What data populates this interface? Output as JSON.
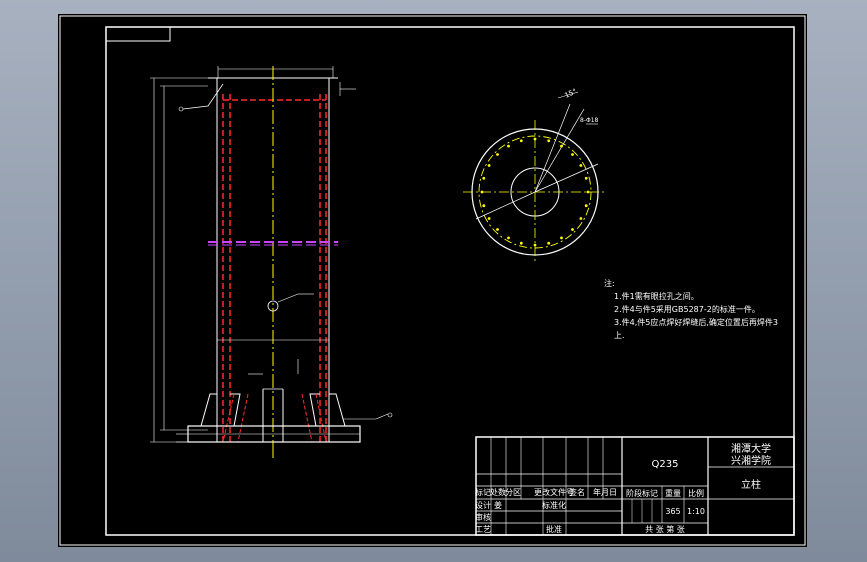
{
  "title_block": {
    "material": "Q235",
    "school_line1": "湘潭大学",
    "school_line2": "兴湘学院",
    "part_name": "立柱",
    "headers_left": [
      "标记",
      "处数",
      "分区",
      "更改文件号",
      "签名",
      "年月日"
    ],
    "row_design": [
      "设计",
      "姜",
      "",
      "标准化"
    ],
    "row_review": [
      "审核",
      "",
      "",
      ""
    ],
    "row_process": [
      "工艺",
      "",
      "",
      "批准"
    ],
    "stage_label": "阶段标记",
    "weight_label": "重量",
    "scale_label": "比例",
    "weight_value": "365",
    "scale_value": "1:10",
    "sheet_text": "共  张  第  张"
  },
  "notes": {
    "heading": "注:",
    "lines": [
      "1.件1需有眼拉孔之间。",
      "2.件4与件5采用GB5287-2的标准一件。",
      "3.件4,件5应点焊好焊缝后,确定位置后再焊件3",
      "上."
    ]
  },
  "dimensions": {
    "angle_label": "15°",
    "hole_label": "8-Φ18"
  },
  "colors": {
    "frame": "#ffffff",
    "hidden_lines": "#ff2a2a",
    "center_lines": "#ffff00",
    "accent": "#cc44ff",
    "background": "#000000"
  }
}
